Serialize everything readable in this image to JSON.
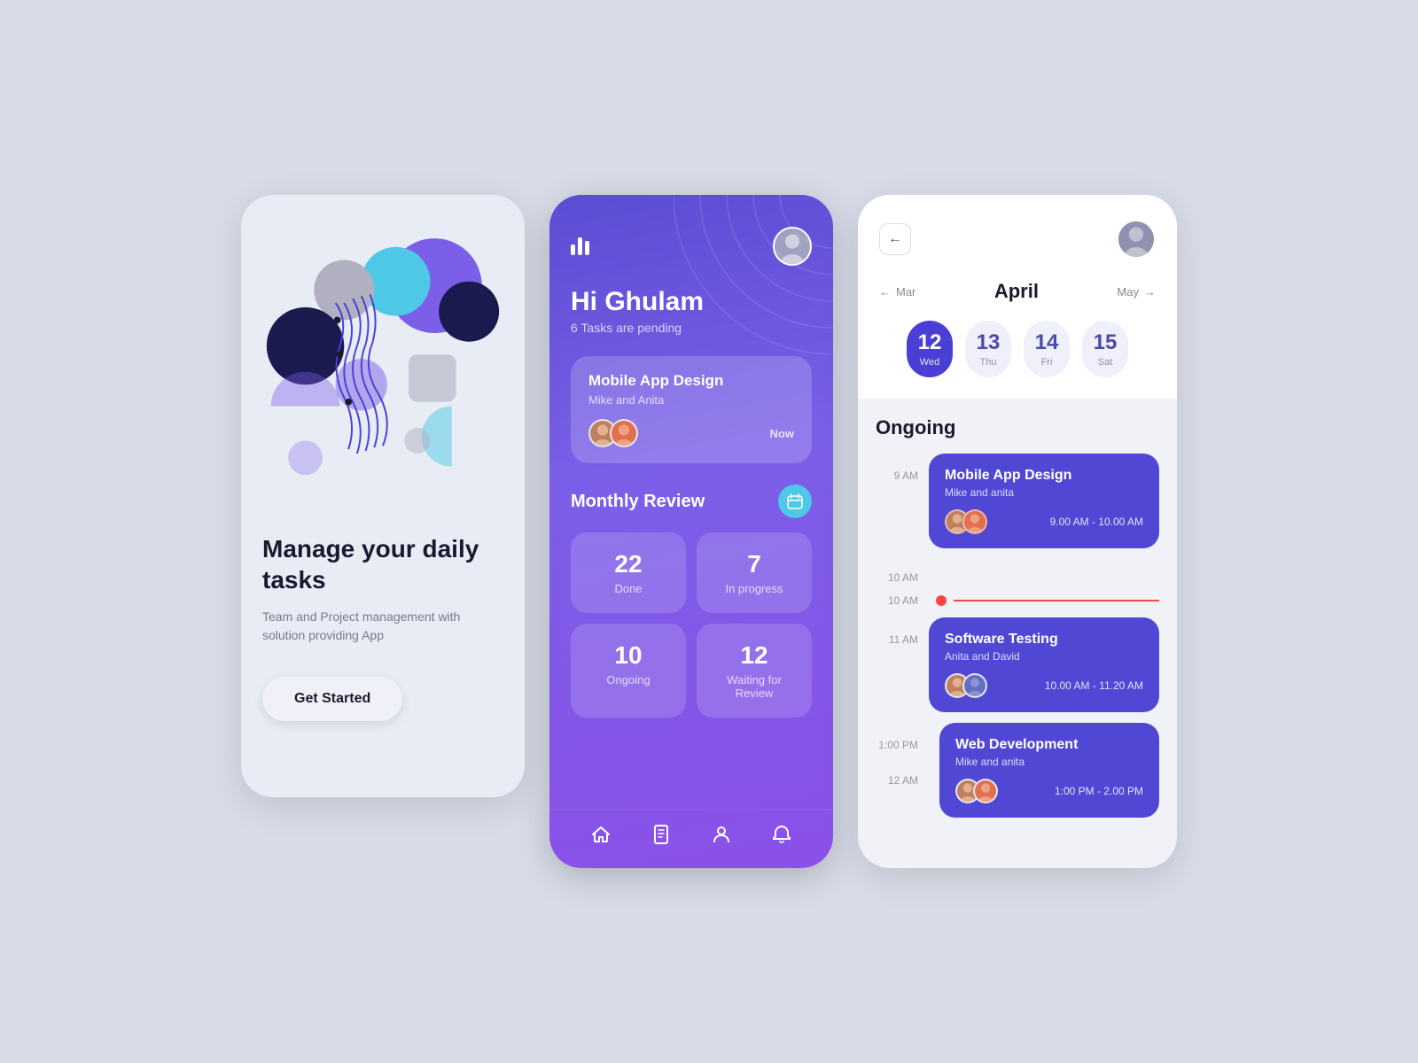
{
  "screen1": {
    "title": "Manage your daily tasks",
    "subtitle": "Team and Project management with solution providing App",
    "btn_label": "Get Started"
  },
  "screen2": {
    "greeting": "Hi Ghulam",
    "tasks_pending": "6 Tasks are pending",
    "task_card": {
      "title": "Mobile App Design",
      "subtitle": "Mike and Anita",
      "time": "Now"
    },
    "review_section": {
      "title": "Monthly Review",
      "stats": [
        {
          "number": "22",
          "label": "Done"
        },
        {
          "number": "7",
          "label": "In progress"
        },
        {
          "number": "10",
          "label": "Ongoing"
        },
        {
          "number": "12",
          "label": "Waiting for Review"
        }
      ]
    },
    "nav": [
      "home",
      "document",
      "person",
      "bell"
    ]
  },
  "screen3": {
    "back_label": "←",
    "month_prev": "Mar",
    "month_current": "April",
    "month_next": "May",
    "days": [
      {
        "num": "12",
        "day": "Wed",
        "active": true
      },
      {
        "num": "13",
        "day": "Thu",
        "active": false
      },
      {
        "num": "14",
        "day": "Fri",
        "active": false
      },
      {
        "num": "15",
        "day": "Sat",
        "active": false
      }
    ],
    "ongoing_title": "Ongoing",
    "events": [
      {
        "time_start": "9 AM",
        "title": "Mobile App Design",
        "subtitle": "Mike and anita",
        "time_range": "9.00 AM - 10.00 AM"
      },
      {
        "time_start": "10 AM",
        "current_time": true
      },
      {
        "time_start": "11 AM",
        "title": "Software Testing",
        "subtitle": "Anita and David",
        "time_range": "10.00 AM - 11.20 AM"
      },
      {
        "time_start": "1:00 PM",
        "title": "Web Development",
        "subtitle": "Mike and anita",
        "time_range": "1:00 PM - 2.00 PM"
      }
    ],
    "second_time_label": "12 AM"
  }
}
